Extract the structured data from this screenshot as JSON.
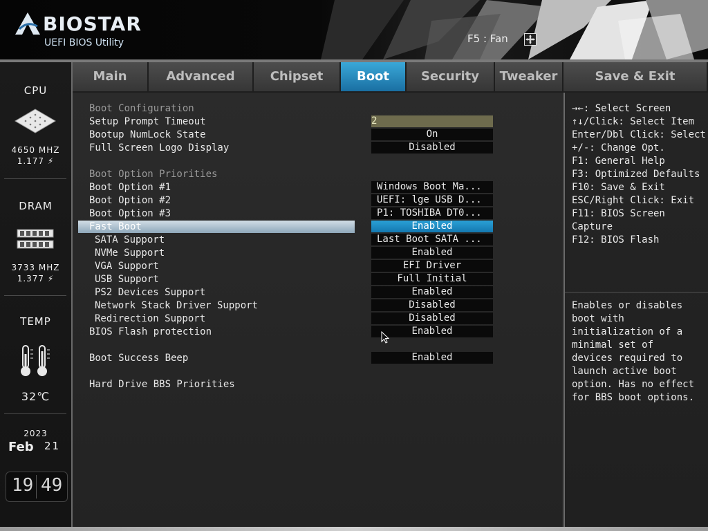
{
  "header": {
    "brand": "BIOSTAR",
    "subtitle": "UEFI BIOS Utility",
    "fan_hint": "F5 : Fan"
  },
  "sidebar": {
    "cpu_label": "CPU",
    "cpu_freq": "4650 MHZ",
    "cpu_volt": "1.177 ⚡",
    "dram_label": "DRAM",
    "dram_freq": "3733 MHZ",
    "dram_volt": "1.377 ⚡",
    "temp_label": "TEMP",
    "temp_value": "32℃",
    "year": "2023",
    "month": "Feb",
    "day": "21",
    "hour": "19",
    "minute": "49"
  },
  "tabs": [
    "Main",
    "Advanced",
    "Chipset",
    "Boot",
    "Security",
    "Tweaker",
    "Save & Exit"
  ],
  "active_tab": "Boot",
  "settings": {
    "boot_config_header": "Boot Configuration",
    "setup_prompt_timeout": {
      "label": "Setup Prompt Timeout",
      "value": "2"
    },
    "numlock": {
      "label": "Bootup NumLock State",
      "value": "On"
    },
    "logo": {
      "label": "Full Screen Logo Display",
      "value": "Disabled"
    },
    "priorities_header": "Boot Option Priorities",
    "boot1": {
      "label": "Boot Option #1",
      "value": "Windows Boot Ma..."
    },
    "boot2": {
      "label": "Boot Option #2",
      "value": "UEFI: lge USB D..."
    },
    "boot3": {
      "label": "Boot Option #3",
      "value": "P1: TOSHIBA DT0..."
    },
    "fast_boot": {
      "label": "Fast Boot",
      "value": "Enabled"
    },
    "sata": {
      "label": "SATA Support",
      "value": "Last Boot SATA ..."
    },
    "nvme": {
      "label": "NVMe Support",
      "value": "Enabled"
    },
    "vga": {
      "label": "VGA Support",
      "value": "EFI Driver"
    },
    "usb": {
      "label": "USB Support",
      "value": "Full Initial"
    },
    "ps2": {
      "label": "PS2 Devices Support",
      "value": "Enabled"
    },
    "netstack": {
      "label": "Network Stack Driver Support",
      "value": "Disabled"
    },
    "redirection": {
      "label": "Redirection Support",
      "value": "Disabled"
    },
    "bios_flash": {
      "label": "BIOS Flash protection",
      "value": "Enabled"
    },
    "beep": {
      "label": "Boot Success Beep",
      "value": "Enabled"
    },
    "bbs": {
      "label": "Hard Drive BBS Priorities"
    }
  },
  "help": {
    "keys": [
      "→←: Select Screen",
      "↑↓/Click: Select Item",
      "Enter/Dbl Click: Select",
      "+/-: Change Opt.",
      "F1: General Help",
      "F3: Optimized Defaults",
      "F10: Save & Exit",
      "ESC/Right Click: Exit",
      "F11: BIOS Screen",
      "Capture",
      "F12: BIOS Flash"
    ],
    "description": [
      "Enables or disables",
      "boot with",
      "initialization of a",
      "minimal set of",
      "devices required to",
      "launch active boot",
      "option. Has no effect",
      "for BBS boot options."
    ]
  },
  "colors": {
    "accent": "#1a8cc8",
    "highlight": "#a9bccb",
    "input_bg": "#6e6b4d"
  }
}
